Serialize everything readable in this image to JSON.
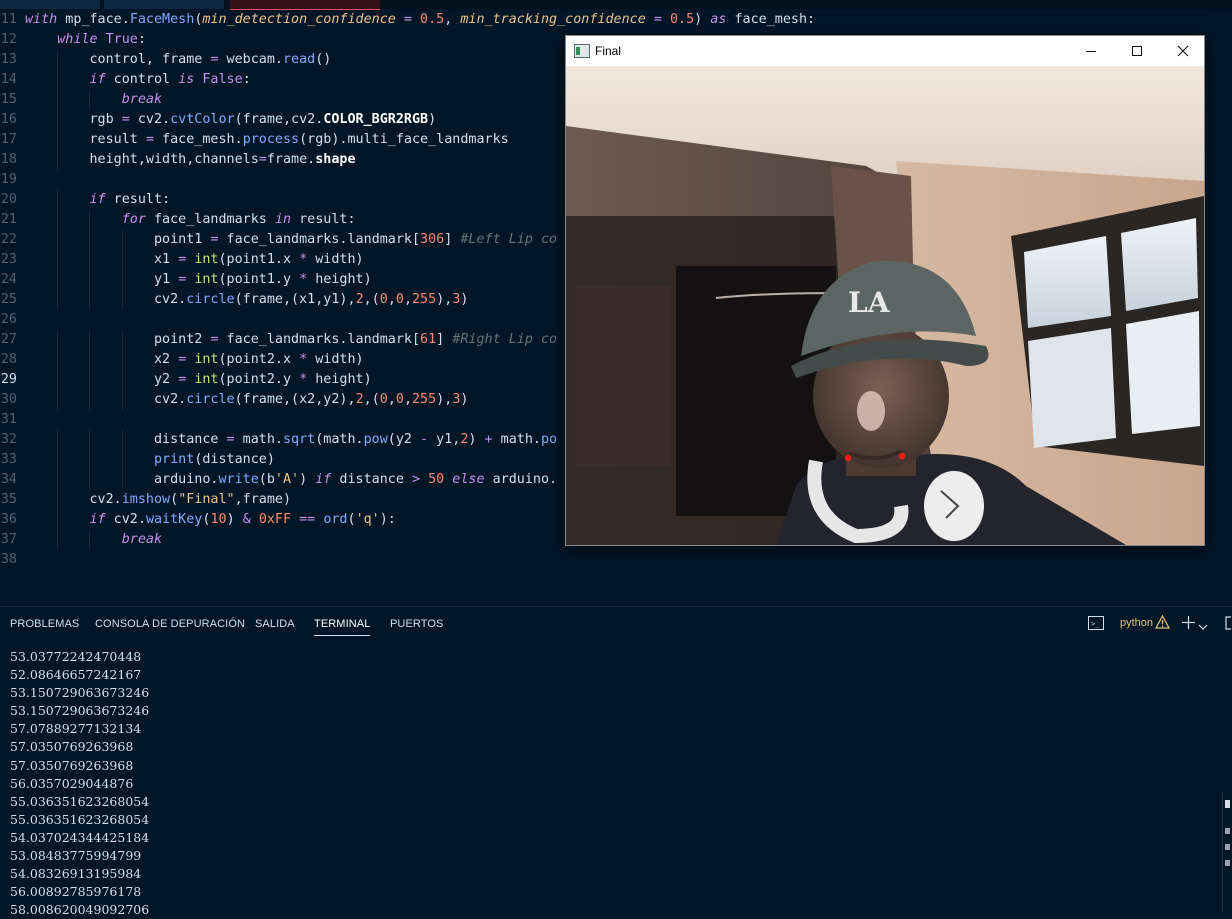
{
  "editor": {
    "current_line": 29,
    "lines": [
      {
        "n": 11,
        "segs": [
          [
            "kw",
            "with"
          ],
          [
            "src",
            " mp_face."
          ],
          [
            "fn",
            "FaceMesh"
          ],
          [
            "src",
            "("
          ],
          [
            "prm",
            "min_detection_confidence"
          ],
          [
            "src",
            " "
          ],
          [
            "op",
            "="
          ],
          [
            "src",
            " "
          ],
          [
            "num",
            "0.5"
          ],
          [
            "src",
            ", "
          ],
          [
            "prm",
            "min_tracking_confidence"
          ],
          [
            "src",
            " "
          ],
          [
            "op",
            "="
          ],
          [
            "src",
            " "
          ],
          [
            "num",
            "0.5"
          ],
          [
            "src",
            ") "
          ],
          [
            "kw",
            "as"
          ],
          [
            "src",
            " face_mesh:"
          ]
        ]
      },
      {
        "n": 12,
        "segs": [
          [
            "src",
            "    "
          ],
          [
            "kw",
            "while"
          ],
          [
            "src",
            " "
          ],
          [
            "kc",
            "True"
          ],
          [
            "src",
            ":"
          ]
        ]
      },
      {
        "n": 13,
        "segs": [
          [
            "src",
            "        control, frame "
          ],
          [
            "op",
            "="
          ],
          [
            "src",
            " webcam."
          ],
          [
            "fn",
            "read"
          ],
          [
            "src",
            "()"
          ]
        ]
      },
      {
        "n": 14,
        "segs": [
          [
            "src",
            "        "
          ],
          [
            "kw",
            "if"
          ],
          [
            "src",
            " control "
          ],
          [
            "kw",
            "is"
          ],
          [
            "src",
            " "
          ],
          [
            "kc",
            "False"
          ],
          [
            "src",
            ":"
          ]
        ]
      },
      {
        "n": 15,
        "segs": [
          [
            "src",
            "            "
          ],
          [
            "kw",
            "break"
          ]
        ]
      },
      {
        "n": 16,
        "segs": [
          [
            "src",
            "        rgb "
          ],
          [
            "op",
            "="
          ],
          [
            "src",
            " cv2."
          ],
          [
            "fn",
            "cvtColor"
          ],
          [
            "src",
            "(frame,cv2."
          ],
          [
            "bo",
            "COLOR_BGR2RGB"
          ],
          [
            "src",
            ")"
          ]
        ]
      },
      {
        "n": 17,
        "segs": [
          [
            "src",
            "        result "
          ],
          [
            "op",
            "="
          ],
          [
            "src",
            " face_mesh."
          ],
          [
            "fn",
            "process"
          ],
          [
            "src",
            "(rgb).multi_face_landmarks"
          ]
        ]
      },
      {
        "n": 18,
        "segs": [
          [
            "src",
            "        height,width,channels"
          ],
          [
            "op",
            "="
          ],
          [
            "src",
            "frame."
          ],
          [
            "bo",
            "shape"
          ]
        ]
      },
      {
        "n": 19,
        "segs": []
      },
      {
        "n": 20,
        "segs": [
          [
            "src",
            "        "
          ],
          [
            "kw",
            "if"
          ],
          [
            "src",
            " result:"
          ]
        ]
      },
      {
        "n": 21,
        "segs": [
          [
            "src",
            "            "
          ],
          [
            "kw",
            "for"
          ],
          [
            "src",
            " face_landmarks "
          ],
          [
            "kw",
            "in"
          ],
          [
            "src",
            " result:"
          ]
        ]
      },
      {
        "n": 22,
        "segs": [
          [
            "src",
            "                point1 "
          ],
          [
            "op",
            "="
          ],
          [
            "src",
            " face_landmarks.landmark["
          ],
          [
            "num",
            "306"
          ],
          [
            "src",
            "] "
          ],
          [
            "cm",
            "#Left Lip co"
          ]
        ]
      },
      {
        "n": 23,
        "segs": [
          [
            "src",
            "                x1 "
          ],
          [
            "op",
            "="
          ],
          [
            "src",
            " "
          ],
          [
            "bi",
            "int"
          ],
          [
            "src",
            "(point1.x "
          ],
          [
            "op",
            "*"
          ],
          [
            "src",
            " width)"
          ]
        ]
      },
      {
        "n": 24,
        "segs": [
          [
            "src",
            "                y1 "
          ],
          [
            "op",
            "="
          ],
          [
            "src",
            " "
          ],
          [
            "bi",
            "int"
          ],
          [
            "src",
            "(point1.y "
          ],
          [
            "op",
            "*"
          ],
          [
            "src",
            " height)"
          ]
        ]
      },
      {
        "n": 25,
        "segs": [
          [
            "src",
            "                cv2."
          ],
          [
            "fn",
            "circle"
          ],
          [
            "src",
            "(frame,(x1,y1),"
          ],
          [
            "num",
            "2"
          ],
          [
            "src",
            ",("
          ],
          [
            "num",
            "0"
          ],
          [
            "src",
            ","
          ],
          [
            "num",
            "0"
          ],
          [
            "src",
            ","
          ],
          [
            "num",
            "255"
          ],
          [
            "src",
            "),"
          ],
          [
            "num",
            "3"
          ],
          [
            "src",
            ")"
          ]
        ]
      },
      {
        "n": 26,
        "segs": []
      },
      {
        "n": 27,
        "segs": [
          [
            "src",
            "                point2 "
          ],
          [
            "op",
            "="
          ],
          [
            "src",
            " face_landmarks.landmark["
          ],
          [
            "num",
            "61"
          ],
          [
            "src",
            "] "
          ],
          [
            "cm",
            "#Right Lip co"
          ]
        ]
      },
      {
        "n": 28,
        "segs": [
          [
            "src",
            "                x2 "
          ],
          [
            "op",
            "="
          ],
          [
            "src",
            " "
          ],
          [
            "bi",
            "int"
          ],
          [
            "src",
            "(point2.x "
          ],
          [
            "op",
            "*"
          ],
          [
            "src",
            " width)"
          ]
        ]
      },
      {
        "n": 29,
        "segs": [
          [
            "src",
            "                y2 "
          ],
          [
            "op",
            "="
          ],
          [
            "src",
            " "
          ],
          [
            "bi",
            "int"
          ],
          [
            "src",
            "(point2.y "
          ],
          [
            "op",
            "*"
          ],
          [
            "src",
            " height)"
          ]
        ]
      },
      {
        "n": 30,
        "segs": [
          [
            "src",
            "                cv2."
          ],
          [
            "fn",
            "circle"
          ],
          [
            "src",
            "(frame,(x2,y2),"
          ],
          [
            "num",
            "2"
          ],
          [
            "src",
            ",("
          ],
          [
            "num",
            "0"
          ],
          [
            "src",
            ","
          ],
          [
            "num",
            "0"
          ],
          [
            "src",
            ","
          ],
          [
            "num",
            "255"
          ],
          [
            "src",
            "),"
          ],
          [
            "num",
            "3"
          ],
          [
            "src",
            ")"
          ]
        ]
      },
      {
        "n": 31,
        "segs": []
      },
      {
        "n": 32,
        "segs": [
          [
            "src",
            "                distance "
          ],
          [
            "op",
            "="
          ],
          [
            "src",
            " math."
          ],
          [
            "fn",
            "sqrt"
          ],
          [
            "src",
            "(math."
          ],
          [
            "fn",
            "pow"
          ],
          [
            "src",
            "(y2 "
          ],
          [
            "op",
            "-"
          ],
          [
            "src",
            " y1,"
          ],
          [
            "num",
            "2"
          ],
          [
            "src",
            ") "
          ],
          [
            "op",
            "+"
          ],
          [
            "src",
            " math."
          ],
          [
            "fn",
            "po"
          ]
        ]
      },
      {
        "n": 33,
        "segs": [
          [
            "src",
            "                "
          ],
          [
            "fn",
            "print"
          ],
          [
            "src",
            "(distance)"
          ]
        ]
      },
      {
        "n": 34,
        "segs": [
          [
            "src",
            "                arduino."
          ],
          [
            "fn",
            "write"
          ],
          [
            "src",
            "(b"
          ],
          [
            "str",
            "'A'"
          ],
          [
            "src",
            ") "
          ],
          [
            "kw",
            "if"
          ],
          [
            "src",
            " distance "
          ],
          [
            "op",
            ">"
          ],
          [
            "src",
            " "
          ],
          [
            "num",
            "50"
          ],
          [
            "src",
            " "
          ],
          [
            "kw",
            "else"
          ],
          [
            "src",
            " arduino."
          ]
        ]
      },
      {
        "n": 35,
        "segs": [
          [
            "src",
            "        cv2."
          ],
          [
            "fn",
            "imshow"
          ],
          [
            "src",
            "("
          ],
          [
            "str",
            "\"Final\""
          ],
          [
            "src",
            ",frame)"
          ]
        ]
      },
      {
        "n": 36,
        "segs": [
          [
            "src",
            "        "
          ],
          [
            "kw",
            "if"
          ],
          [
            "src",
            " cv2."
          ],
          [
            "fn",
            "waitKey"
          ],
          [
            "src",
            "("
          ],
          [
            "num",
            "10"
          ],
          [
            "src",
            ") "
          ],
          [
            "op",
            "&"
          ],
          [
            "src",
            " "
          ],
          [
            "num",
            "0xFF"
          ],
          [
            "src",
            " "
          ],
          [
            "op",
            "=="
          ],
          [
            "src",
            " "
          ],
          [
            "fn",
            "ord"
          ],
          [
            "src",
            "("
          ],
          [
            "str",
            "'q'"
          ],
          [
            "src",
            "):"
          ]
        ]
      },
      {
        "n": 37,
        "segs": [
          [
            "src",
            "            "
          ],
          [
            "kw",
            "break"
          ]
        ]
      },
      {
        "n": 38,
        "segs": []
      }
    ]
  },
  "cv_window": {
    "title": "Final",
    "icons": {
      "app": "opencv-window-icon",
      "minimize": "minimize-icon",
      "maximize": "maximize-icon",
      "close": "close-icon"
    },
    "landmark_color": "#ff1a1a"
  },
  "panel": {
    "tabs": [
      {
        "label": "PROBLEMAS",
        "active": false
      },
      {
        "label": "CONSOLA DE DEPURACIÓN",
        "active": false
      },
      {
        "label": "SALIDA",
        "active": false
      },
      {
        "label": "TERMINAL",
        "active": true
      },
      {
        "label": "PUERTOS",
        "active": false
      }
    ],
    "terminal_name": "python",
    "terminal_icons": {
      "terminal": "terminal-icon",
      "warning": "warning-icon",
      "add": "plus-icon",
      "dropdown": "chevron-down-icon"
    },
    "output": [
      "53.03772242470448",
      "52.08646657242167",
      "53.150729063673246",
      "53.150729063673246",
      "57.07889277132134",
      "57.0350769263968",
      "57.0350769263968",
      "56.0357029044876",
      "55.036351623268054",
      "55.036351623268054",
      "54.037024344425184",
      "53.08483775994799",
      "54.08326913195984",
      "56.00892785976178",
      "58.008620049092706"
    ]
  },
  "colors": {
    "background": "#011627",
    "accent_warning": "#e6c07b",
    "terminal_name": "#e6c07b"
  }
}
